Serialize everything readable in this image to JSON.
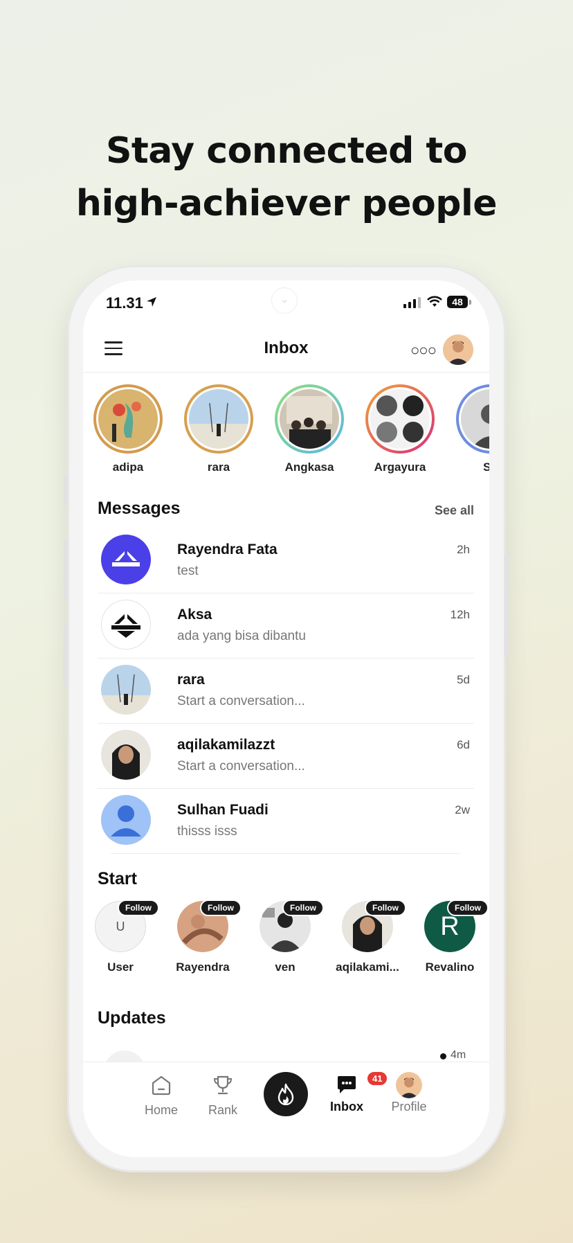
{
  "headline": {
    "line1": "Stay connected to",
    "line2": "high-achiever people"
  },
  "status_bar": {
    "time": "11.31",
    "battery": "48"
  },
  "header": {
    "title": "Inbox"
  },
  "stories": [
    {
      "name": "adipa",
      "ring": "#d39a4e"
    },
    {
      "name": "rara",
      "ring": "#d6a050"
    },
    {
      "name": "Angkasa",
      "ring": "#6fd3a0"
    },
    {
      "name": "Argayura",
      "ring": "#e0673c"
    },
    {
      "name": "Su",
      "ring": "#6d8de0"
    }
  ],
  "messages": {
    "title": "Messages",
    "see_all": "See all",
    "items": [
      {
        "name": "Rayendra Fata",
        "preview": "test",
        "time": "2h"
      },
      {
        "name": "Aksa",
        "preview": "ada yang bisa dibantu",
        "time": "12h"
      },
      {
        "name": "rara",
        "preview": "Start a conversation...",
        "time": "5d"
      },
      {
        "name": "aqilakamilazzt",
        "preview": "Start a conversation...",
        "time": "6d"
      },
      {
        "name": "Sulhan Fuadi",
        "preview": "thisss isss",
        "time": "2w"
      }
    ]
  },
  "start": {
    "title": "Start",
    "follow_label": "Follow",
    "items": [
      {
        "name": "User",
        "initial": "U"
      },
      {
        "name": "Rayendra"
      },
      {
        "name": "ven"
      },
      {
        "name": "aqilakami..."
      },
      {
        "name": "Revalino",
        "initial": "R"
      }
    ]
  },
  "updates": {
    "title": "Updates",
    "time": "4m"
  },
  "tabbar": {
    "home": "Home",
    "rank": "Rank",
    "inbox": "Inbox",
    "inbox_badge": "41",
    "profile": "Profile"
  },
  "colors": {
    "brand_purple": "#4b3fe8",
    "badge_red": "#e53935",
    "follow_green": "#0f5a45"
  }
}
